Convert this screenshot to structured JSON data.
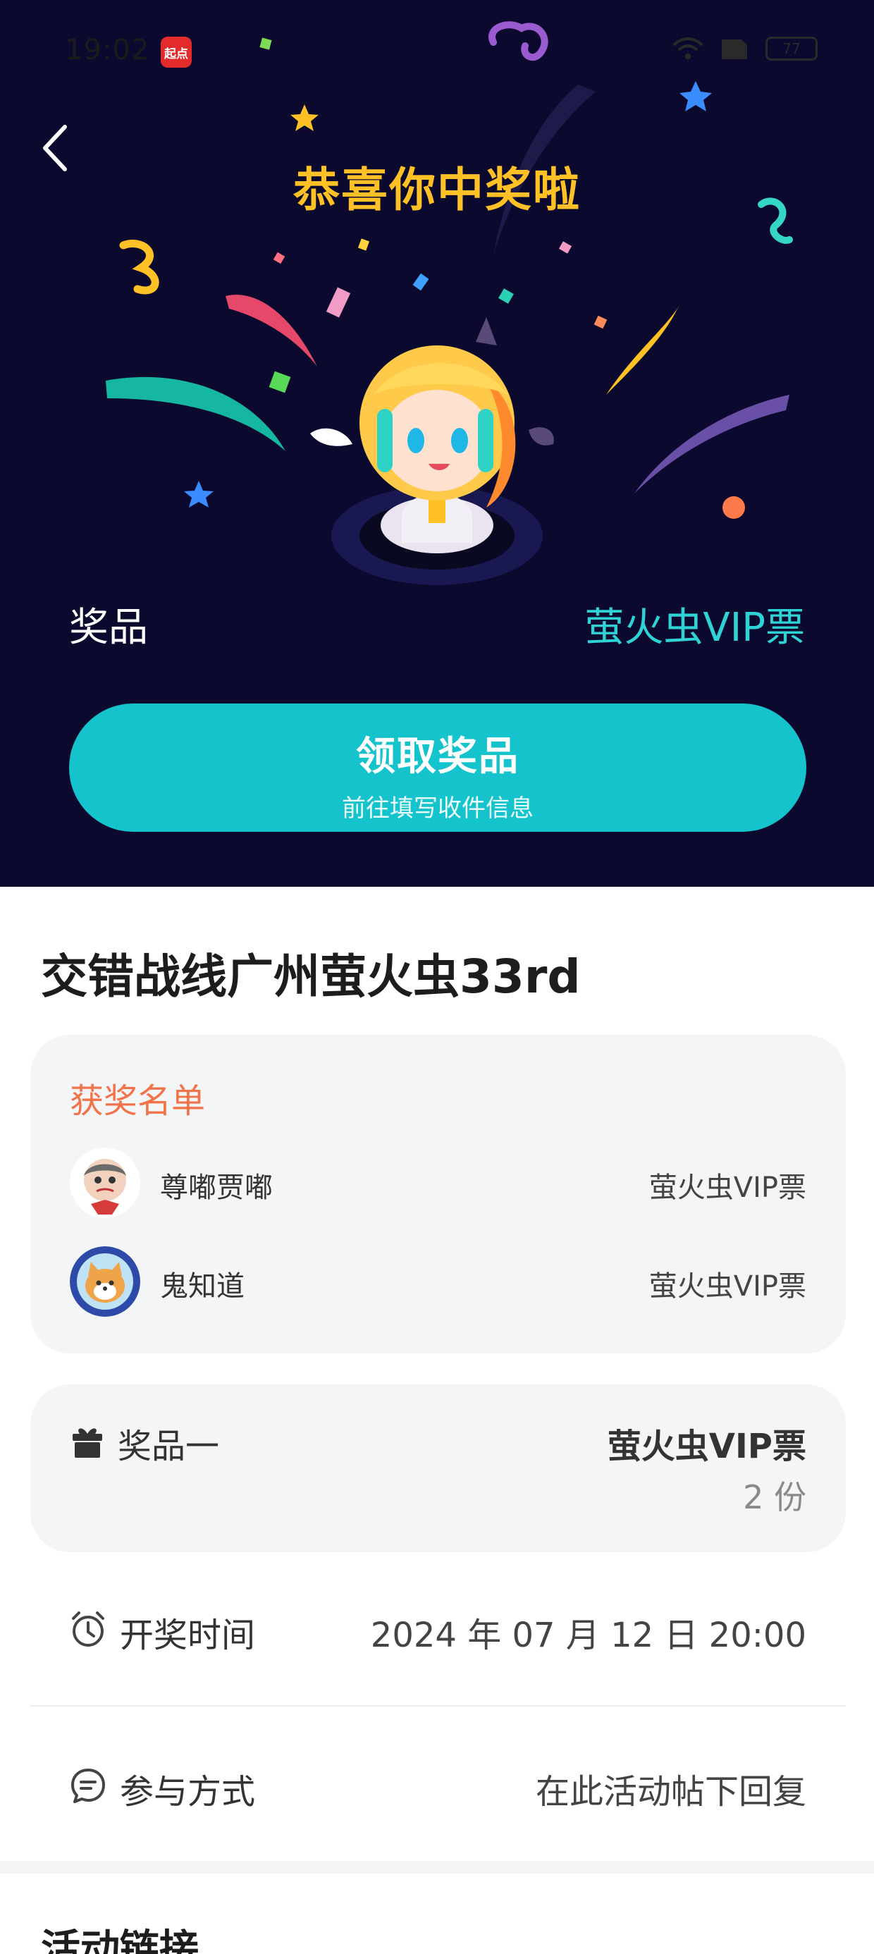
{
  "status_bar": {
    "time": "19:02",
    "app_badge": "起点",
    "battery": "77"
  },
  "hero": {
    "title": "恭喜你中奖啦",
    "prize_label": "奖品",
    "prize_value": "萤火虫VIP票",
    "claim_button": {
      "label": "领取奖品",
      "sublabel": "前往填写收件信息"
    }
  },
  "event": {
    "title": "交错战线广州萤火虫33rd"
  },
  "winners": {
    "heading": "获奖名单",
    "list": [
      {
        "name": "尊嘟贾嘟",
        "prize": "萤火虫VIP票"
      },
      {
        "name": "鬼知道",
        "prize": "萤火虫VIP票"
      }
    ]
  },
  "prize_item": {
    "label": "奖品一",
    "value": "萤火虫VIP票",
    "count": "2 份"
  },
  "draw_time": {
    "label": "开奖时间",
    "value": "2024 年 07 月 12 日 20:00"
  },
  "participation": {
    "label": "参与方式",
    "value": "在此活动帖下回复"
  },
  "links": {
    "title": "活动链接"
  },
  "colors": {
    "hero_bg": "#0b0a2e",
    "title_yellow": "#ffc125",
    "accent_teal": "#14c3cb",
    "winners_orange": "#f2734a"
  }
}
